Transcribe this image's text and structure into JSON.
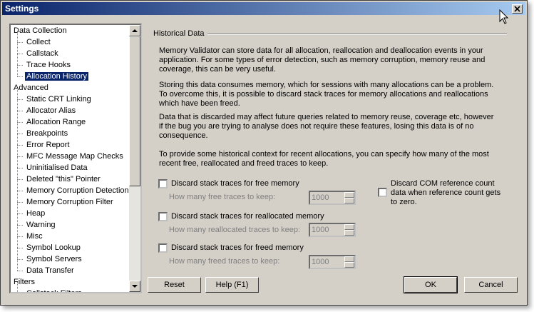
{
  "window": {
    "title": "Settings"
  },
  "tree": {
    "items": [
      {
        "label": "Data Collection",
        "level": 0
      },
      {
        "label": "Collect",
        "level": 1
      },
      {
        "label": "Callstack",
        "level": 1
      },
      {
        "label": "Trace Hooks",
        "level": 1
      },
      {
        "label": "Allocation History",
        "level": 1,
        "selected": true
      },
      {
        "label": "Advanced",
        "level": 0
      },
      {
        "label": "Static CRT Linking",
        "level": 1
      },
      {
        "label": "Allocator Alias",
        "level": 1
      },
      {
        "label": "Allocation Range",
        "level": 1
      },
      {
        "label": "Breakpoints",
        "level": 1
      },
      {
        "label": "Error Report",
        "level": 1
      },
      {
        "label": "MFC Message Map Checks",
        "level": 1
      },
      {
        "label": "Uninitialised Data",
        "level": 1
      },
      {
        "label": "Deleted \"this\" Pointer",
        "level": 1
      },
      {
        "label": "Memory Corruption Detection",
        "level": 1
      },
      {
        "label": "Memory Corruption Filter",
        "level": 1
      },
      {
        "label": "Heap",
        "level": 1
      },
      {
        "label": "Warning",
        "level": 1
      },
      {
        "label": "Misc",
        "level": 1
      },
      {
        "label": "Symbol Lookup",
        "level": 1
      },
      {
        "label": "Symbol Servers",
        "level": 1
      },
      {
        "label": "Data Transfer",
        "level": 1
      },
      {
        "label": "Filters",
        "level": 0
      },
      {
        "label": "Callstack Filters",
        "level": 1
      }
    ]
  },
  "panel": {
    "group_title": "Historical Data",
    "para1": "Memory Validator can store data for all allocation, reallocation and deallocation events in your application. For some types of error detection, such as memory corruption, memory reuse and coverage, this can be very useful.",
    "para2": "Storing this data consumes memory, which for sessions with many allocations can be a problem. To overcome this, it is possible to discard stack traces for memory allocations and reallocations which have been freed.",
    "para3": "Data that is discarded may affect future queries related to memory reuse, coverage etc, however if the bug you are trying to analyse does not require these features, losing this data is of no consequence.",
    "para4": "To provide some historical context for recent allocations, you can specify how many of the most recent free, reallocated and freed traces to keep.",
    "opt_free": {
      "label": "Discard stack traces for free memory",
      "sublabel": "How many free traces to keep:",
      "value": "1000"
    },
    "opt_realloc": {
      "label": "Discard stack traces for reallocated memory",
      "sublabel": "How many reallocated traces to keep:",
      "value": "1000"
    },
    "opt_freed": {
      "label": "Discard stack traces for freed memory",
      "sublabel": "How many freed traces to keep:",
      "value": "1000"
    },
    "opt_com": {
      "label": "Discard COM reference count data when reference count gets to zero."
    }
  },
  "buttons": {
    "reset": "Reset",
    "help": "Help (F1)",
    "ok": "OK",
    "cancel": "Cancel"
  },
  "colors": {
    "title_start": "#0a246a",
    "title_end": "#a6caf0",
    "face": "#d4d0c8",
    "selection": "#0a246a"
  }
}
